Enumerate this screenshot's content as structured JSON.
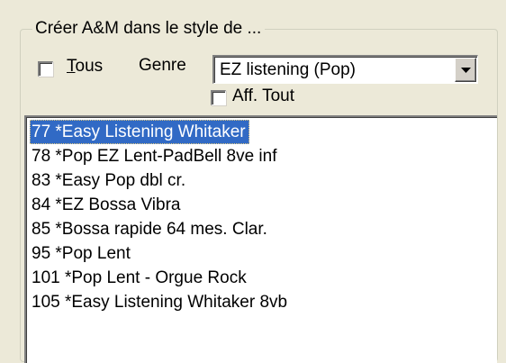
{
  "group": {
    "legend": "Créer A&M dans le style de ..."
  },
  "filters": {
    "all_checkbox": {
      "mnemonic": "T",
      "rest": "ous",
      "checked": false
    },
    "genre_label": "Genre",
    "genre_value": "EZ listening (Pop)",
    "show_all_checkbox": {
      "label": "Aff. Tout",
      "checked": false
    }
  },
  "styles_list": {
    "selected_index": 0,
    "items": [
      "77 *Easy Listening Whitaker",
      "78 *Pop EZ Lent-PadBell 8ve inf",
      "83 *Easy Pop dbl cr.",
      "84 *EZ Bossa Vibra",
      "85 *Bossa rapide 64 mes. Clar.",
      "95 *Pop Lent",
      "101 *Pop Lent - Orgue Rock",
      "105 *Easy Listening Whitaker 8vb"
    ]
  },
  "colors": {
    "selection_background": "#316ac5",
    "selection_text": "#ffffff",
    "dialog_background": "#ece9d8"
  },
  "icons": {
    "combo_button": "chevron-down-icon"
  }
}
